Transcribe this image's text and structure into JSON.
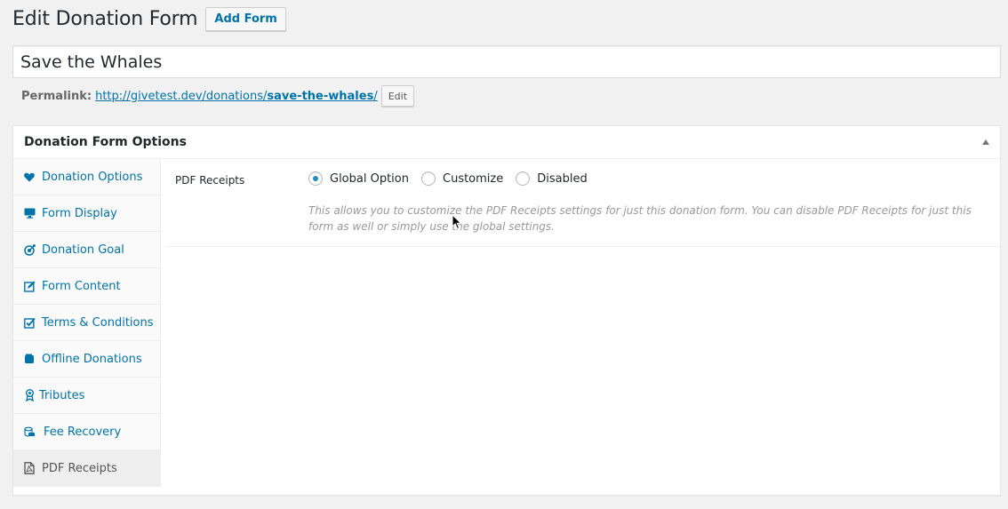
{
  "header": {
    "title": "Edit Donation Form",
    "add_form_label": "Add Form"
  },
  "post_title": {
    "value": "Save the Whales"
  },
  "permalink": {
    "label": "Permalink:",
    "url_prefix": "http://givetest.dev/donations/",
    "slug": "save-the-whales",
    "url_suffix": "/",
    "edit_label": "Edit"
  },
  "metabox": {
    "title": "Donation Form Options",
    "tabs": [
      {
        "label": "Donation Options",
        "icon": "heart-icon"
      },
      {
        "label": "Form Display",
        "icon": "monitor-icon"
      },
      {
        "label": "Donation Goal",
        "icon": "target-icon"
      },
      {
        "label": "Form Content",
        "icon": "edit-icon"
      },
      {
        "label": "Terms & Conditions",
        "icon": "checkbox-icon"
      },
      {
        "label": "Offline Donations",
        "icon": "wallet-icon"
      },
      {
        "label": "Tributes",
        "icon": "award-icon"
      },
      {
        "label": "Fee Recovery",
        "icon": "coins-icon"
      },
      {
        "label": "PDF Receipts",
        "icon": "pdf-icon",
        "active": true
      }
    ],
    "field": {
      "label": "PDF Receipts",
      "options": [
        "Global Option",
        "Customize",
        "Disabled"
      ],
      "selected": "Global Option",
      "description": "This allows you to customize the PDF Receipts settings for just this donation form. You can disable PDF Receipts for just this form as well or simply use the global settings."
    }
  },
  "colors": {
    "link": "#0073aa",
    "radio_checked": "#1e8cbe",
    "background": "#f1f1f1"
  }
}
